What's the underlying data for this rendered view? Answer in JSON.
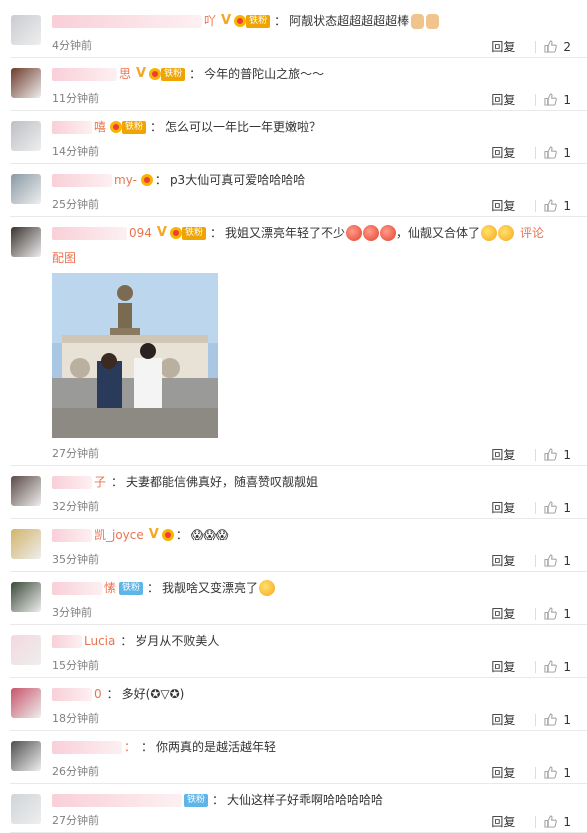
{
  "labels": {
    "reply": "回复",
    "pic": "配图",
    "comment": "评论",
    "fan_tag": "铁粉"
  },
  "comments": [
    {
      "name_tail": "吖",
      "vip": true,
      "fan": "orange",
      "text": "阿靓状态超超超超超棒",
      "time": "4分钟前",
      "likes": "2",
      "av": "#c9ccd1"
    },
    {
      "name_tail": "思",
      "vip": true,
      "fan": "orange",
      "text": "今年的普陀山之旅～～",
      "time": "11分钟前",
      "likes": "1",
      "av": "#6e3a2a"
    },
    {
      "name_tail": "嘻",
      "vip": false,
      "fan": "orange",
      "text": "怎么可以一年比一年更嫩啦？",
      "time": "14分钟前",
      "likes": "1",
      "av": "#bcbfc4"
    },
    {
      "name_tail": "my-",
      "vip": false,
      "fan": "crown",
      "text": "p3大仙可真可爱哈哈哈哈",
      "time": "25分钟前",
      "likes": "1",
      "av": "#8a9aa6"
    },
    {
      "name_tail": "094",
      "vip": true,
      "fan": "orange",
      "text": "我姐又漂亮年轻了不少",
      "text2": "，仙靓又合体了",
      "time": "27分钟前",
      "likes": "1",
      "av": "#3a3330",
      "photo": true
    },
    {
      "name_tail": "子",
      "vip": false,
      "fan": "none",
      "text": "夫妻都能信佛真好，随喜赞叹靓靓姐",
      "time": "32分钟前",
      "likes": "1",
      "av": "#5a4a44"
    },
    {
      "name_tail": "凯_joyce",
      "vip": true,
      "fan": "crown",
      "text": "😱😱😱",
      "time": "35分钟前",
      "likes": "1",
      "av": "#d2b36a"
    },
    {
      "name_tail": "愫",
      "vip": false,
      "fan": "blue",
      "text": "我靓啥又变漂亮了",
      "time": "3分钟前",
      "likes": "1",
      "av": "#3b4a3a"
    },
    {
      "name_tail": "Lucia",
      "vip": false,
      "fan": "none",
      "text": "岁月从不败美人",
      "time": "15分钟前",
      "likes": "1",
      "av": "#f4d8de"
    },
    {
      "name_tail": "0",
      "vip": false,
      "fan": "none",
      "text": "多好(✪▽✪)",
      "time": "18分钟前",
      "likes": "1",
      "av": "#c7546a"
    },
    {
      "name_tail": "：",
      "vip": false,
      "fan": "none",
      "text": "你两真的是越活越年轻",
      "time": "26分钟前",
      "likes": "1",
      "av": "#505050"
    },
    {
      "name_tail": "",
      "vip": false,
      "fan": "blue",
      "text": "大仙这样子好乖啊哈哈哈哈哈",
      "time": "27分钟前",
      "likes": "1",
      "av": "#d0d4d8"
    }
  ]
}
